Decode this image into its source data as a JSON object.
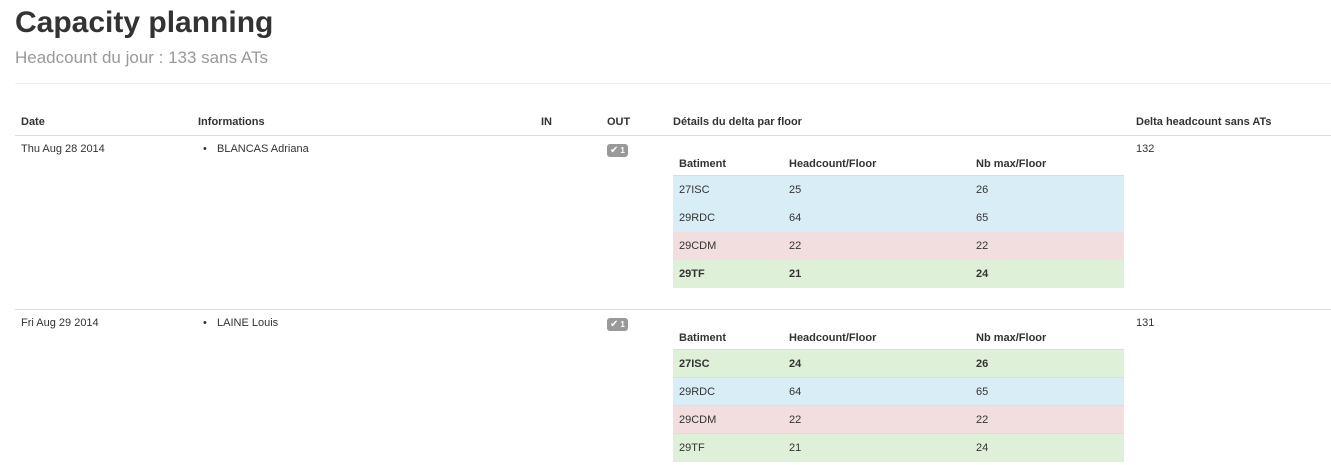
{
  "page": {
    "title": "Capacity planning",
    "subtitle": "Headcount du jour : 133 sans ATs"
  },
  "table": {
    "headers": {
      "date": "Date",
      "informations": "Informations",
      "in": "IN",
      "out": "OUT",
      "details": "Détails du delta par floor",
      "delta": "Delta headcount sans ATs"
    },
    "floor_headers": {
      "batiment": "Batiment",
      "headcount": "Headcount/Floor",
      "nbmax": "Nb max/Floor"
    },
    "rows": [
      {
        "date": "Thu Aug 28 2014",
        "names": [
          "BLANCAS Adriana"
        ],
        "out_badge": {
          "icon": "check-icon",
          "count": "1"
        },
        "delta": "132",
        "floors": [
          {
            "batiment": "27ISC",
            "headcount": "25",
            "nbmax": "26",
            "status": "info",
            "bold": false
          },
          {
            "batiment": "29RDC",
            "headcount": "64",
            "nbmax": "65",
            "status": "info",
            "bold": false
          },
          {
            "batiment": "29CDM",
            "headcount": "22",
            "nbmax": "22",
            "status": "danger",
            "bold": false
          },
          {
            "batiment": "29TF",
            "headcount": "21",
            "nbmax": "24",
            "status": "success",
            "bold": true
          }
        ]
      },
      {
        "date": "Fri Aug 29 2014",
        "names": [
          "LAINE Louis"
        ],
        "out_badge": {
          "icon": "check-icon",
          "count": "1"
        },
        "delta": "131",
        "floors": [
          {
            "batiment": "27ISC",
            "headcount": "24",
            "nbmax": "26",
            "status": "success",
            "bold": true
          },
          {
            "batiment": "29RDC",
            "headcount": "64",
            "nbmax": "65",
            "status": "info",
            "bold": false
          },
          {
            "batiment": "29CDM",
            "headcount": "22",
            "nbmax": "22",
            "status": "danger",
            "bold": false
          },
          {
            "batiment": "29TF",
            "headcount": "21",
            "nbmax": "24",
            "status": "success",
            "bold": false
          }
        ]
      }
    ]
  },
  "colors": {
    "info": "#d9edf7",
    "danger": "#f2dede",
    "success": "#dff0d8",
    "badge": "#999999"
  }
}
